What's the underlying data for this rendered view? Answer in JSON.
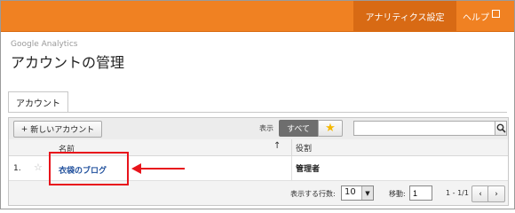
{
  "topbar": {
    "settings_label": "アナリティクス設定",
    "help_label": "ヘルプ",
    "accent_color": "#f08122"
  },
  "header": {
    "product": "Google Analytics",
    "title": "アカウントの管理"
  },
  "tabs": [
    {
      "label": "アカウント",
      "active": true
    }
  ],
  "toolbar": {
    "new_account_label": "新しいアカウント",
    "show_label": "表示",
    "filter_all_label": "すべて",
    "filter_starred_icon": "star-icon",
    "search_value": "",
    "search_icon": "search-icon"
  },
  "table": {
    "columns": {
      "name": "名前",
      "sort_indicator": "↑",
      "role": "役割"
    },
    "rows": [
      {
        "index": "1.",
        "name": "衣袋のブログ",
        "role": "管理者",
        "starred": false
      }
    ]
  },
  "footer": {
    "rows_label": "表示する行数:",
    "rows_value": "10",
    "goto_label": "移動:",
    "goto_value": "1",
    "range": "1 - 1/1",
    "prev_label": "‹",
    "next_label": "›"
  },
  "annotation": {
    "highlight_color": "#e8141c"
  }
}
